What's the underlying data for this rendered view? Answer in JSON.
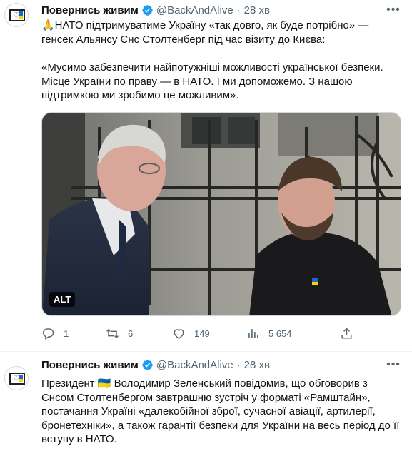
{
  "tweets": [
    {
      "author_name": "Повернись живим",
      "handle": "@BackAndAlive",
      "separator": "·",
      "time": "28 хв",
      "text_paragraphs": [
        "🙏НАТО підтримуватиме Україну «так довго, як буде потрібно» — генсек Альянсу Єнс Столтенберг під час візиту до Києва:",
        "«Мусимо забезпечити найпотужніші можливості української безпеки. Місце України по праву — в НАТО. І ми допоможемо. З нашою підтримкою ми зробимо це можливим»."
      ],
      "media_alt_badge": "ALT",
      "stats": {
        "replies": "1",
        "retweets": "6",
        "likes": "149",
        "views": "5 654"
      }
    },
    {
      "author_name": "Повернись живим",
      "handle": "@BackAndAlive",
      "separator": "·",
      "time": "28 хв",
      "text_paragraphs": [
        "Президент 🇺🇦 Володимир Зеленський повідомив, що обговорив з Єнсом Столтенбергом завтрашню зустріч у форматі «Рамштайн», постачання Україні «далекобійної зброї, сучасної авіації, артилерії, бронетехніки», а також гарантії безпеки для України на весь період до її вступу в НАТО."
      ]
    }
  ],
  "colors": {
    "verified": "#1d9bf0",
    "muted": "#536471",
    "text": "#0f1419"
  }
}
